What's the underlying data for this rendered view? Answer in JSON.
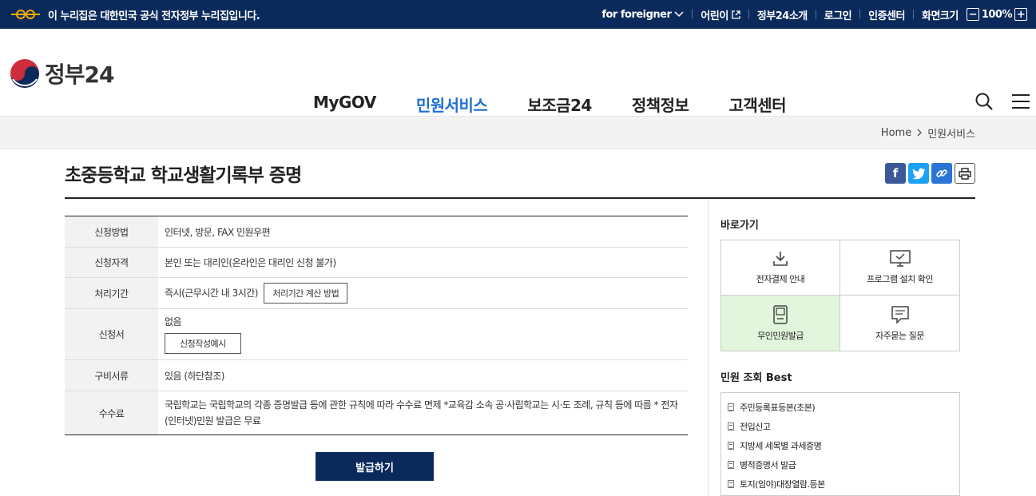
{
  "gov_banner": {
    "notice": "이 누리집은 대한민국 공식 전자정부 누리집입니다.",
    "links": [
      "for foreigner",
      "어린이",
      "정부24소개",
      "로그인",
      "인증센터",
      "화면크기"
    ],
    "zoom_minus": "−",
    "zoom_level": "100%",
    "zoom_plus": "+"
  },
  "header": {
    "brand": "정부24",
    "nav": [
      "MyGOV",
      "민원서비스",
      "보조금24",
      "정책정보",
      "고객센터"
    ],
    "active_nav": "민원서비스"
  },
  "breadcrumb": {
    "home": "Home",
    "current": "민원서비스"
  },
  "page": {
    "title": "초중등학교 학교생활기록부 증명"
  },
  "info": {
    "method_label": "신청방법",
    "method_value": "인터넷, 방문, FAX 민원우편",
    "eligibility_label": "신청자격",
    "eligibility_value": "본인 또는 대리인(온라인은 대리인 신청 불가)",
    "period_label": "처리기간",
    "period_value": "즉시(근무시간 내 3시간)",
    "period_button": "처리기간 계산 방법",
    "form_label": "신청서",
    "form_value": "없음",
    "form_button": "신청작성예시",
    "docs_label": "구비서류",
    "docs_value": "있음 (하단참조)",
    "fee_label": "수수료",
    "fee_value": "국립학교는 국립학교의 각종 증명발급 등에 관한 규칙에 따라 수수료 면제 *교육감 소속 공·사립학교는 시·도 조례, 규칙 등에 따름 * 전자(인터넷)민원 발급은 무료"
  },
  "issue_button": "발급하기",
  "sidebar": {
    "quick_title": "바로가기",
    "quick": [
      "전자결제 안내",
      "프로그램 설치 확인",
      "무인민원발급",
      "자주묻는 질문"
    ],
    "best_title": "민원 조회 Best",
    "best": [
      "주민등록표등본(초본)",
      "전입신고",
      "지방세 세목별 과세증명",
      "병적증명서 발급",
      "토지(임야)대장열람.등본"
    ]
  },
  "colors": {
    "banner": "#0b2a5c",
    "active_nav": "#1f6fd1",
    "highlight": "#e1f6dc",
    "facebook": "#3b5998",
    "twitter": "#1da1f2",
    "link": "#2a74d6"
  }
}
